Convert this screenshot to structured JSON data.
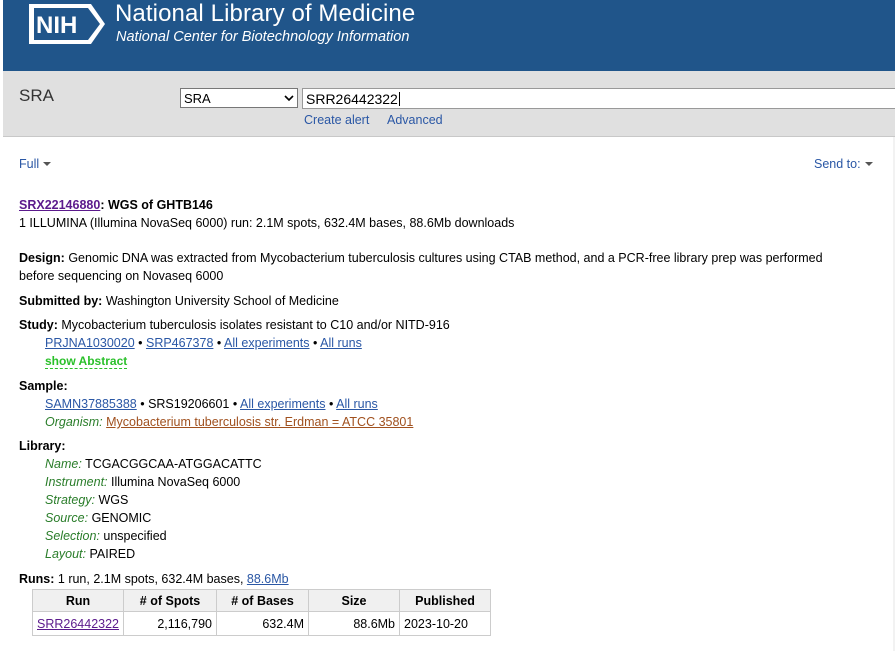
{
  "header": {
    "logo_text": "NIH",
    "title": "National Library of Medicine",
    "subtitle": "National Center for Biotechnology Information"
  },
  "search": {
    "db_label": "SRA",
    "db_selected": "SRA",
    "query": "SRR26442322",
    "create_alert": "Create alert",
    "advanced": "Advanced"
  },
  "toolbar": {
    "format": "Full",
    "send_to": "Send to:"
  },
  "record": {
    "accession": "SRX22146880",
    "title": ": WGS of GHTB146",
    "summary": "1 ILLUMINA (Illumina NovaSeq 6000) run: 2.1M spots, 632.4M bases, 88.6Mb downloads",
    "design_label": "Design:",
    "design_line1": " Genomic DNA was extracted from Mycobacterium tuberculosis cultures using CTAB method, and a PCR-free library prep was performed",
    "design_line2": "before sequencing on Novaseq 6000",
    "submitted_label": "Submitted by:",
    "submitted_value": " Washington University School of Medicine",
    "study_label": "Study:",
    "study_value": " Mycobacterium tuberculosis isolates resistant to C10 and/or NITD-916",
    "study_links": {
      "bioproject": "PRJNA1030020",
      "srp": "SRP467378",
      "all_experiments": "All experiments",
      "all_runs": "All runs",
      "separator": " • "
    },
    "show_abstract": "show Abstract",
    "sample_label": "Sample:",
    "sample_links": {
      "biosample": "SAMN37885388",
      "srs": "SRS19206601",
      "all_experiments": "All experiments",
      "all_runs": "All runs"
    },
    "organism_label": "Organism:",
    "organism_value": "Mycobacterium tuberculosis str. Erdman = ATCC 35801",
    "library_label": "Library:",
    "library": {
      "name_label": "Name:",
      "name_value": " TCGACGGCAA-ATGGACATTC",
      "instrument_label": "Instrument:",
      "instrument_value": " Illumina NovaSeq 6000",
      "strategy_label": "Strategy:",
      "strategy_value": " WGS",
      "source_label": "Source:",
      "source_value": " GENOMIC",
      "selection_label": "Selection:",
      "selection_value": " unspecified",
      "layout_label": "Layout:",
      "layout_value": " PAIRED"
    },
    "runs_label": "Runs:",
    "runs_summary": " 1 run, 2.1M spots, 632.4M bases, ",
    "runs_download": "88.6Mb"
  },
  "runs_table": {
    "headers": [
      "Run",
      "# of Spots",
      "# of Bases",
      "Size",
      "Published"
    ],
    "rows": [
      [
        "SRR26442322",
        "2,116,790",
        "632.4M",
        "88.6Mb",
        "2023-10-20"
      ]
    ]
  },
  "colors": {
    "header_bg": "#20558a",
    "link_blue": "#2a57a5",
    "visited_purple": "#5b1a8c",
    "organism_brown": "#a0501e",
    "label_green": "#2a7d2a"
  }
}
